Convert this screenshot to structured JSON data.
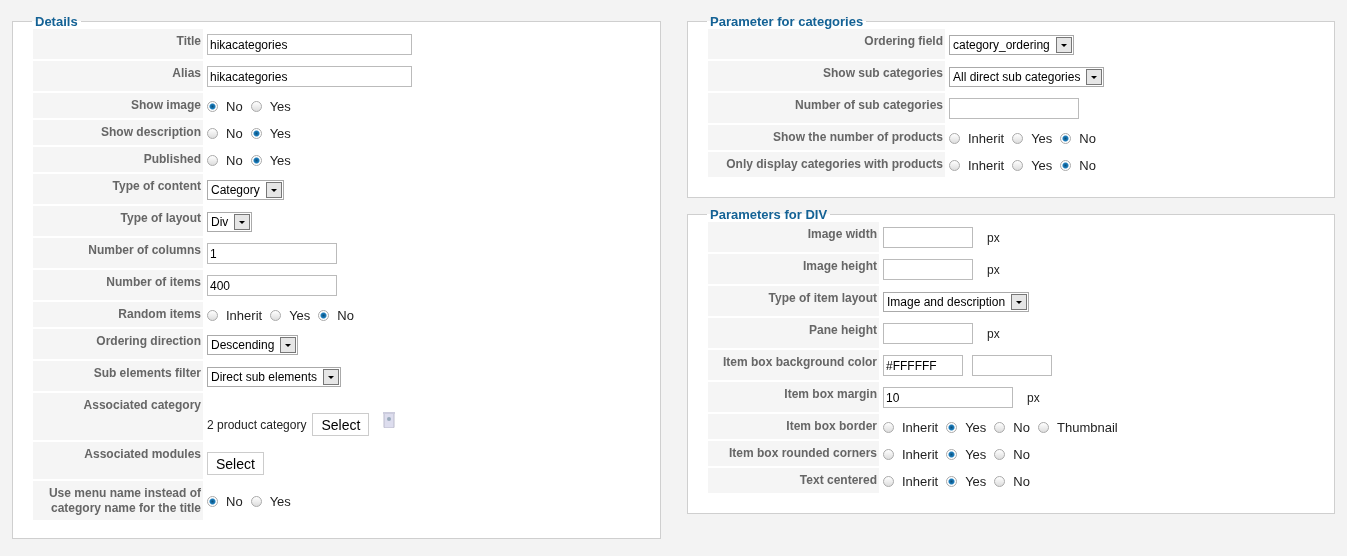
{
  "columns": [
    {
      "sections": [
        {
          "title": "Details",
          "rows": [
            {
              "label": "Title",
              "kind": "long-input",
              "value": "hikacategories"
            },
            {
              "label": "Alias",
              "kind": "long-input",
              "value": "hikacategories"
            },
            {
              "label": "Show image",
              "kind": "radio",
              "options": [
                {
                  "label": "No",
                  "selected": true
                },
                {
                  "label": "Yes",
                  "selected": false
                }
              ]
            },
            {
              "label": "Show description",
              "kind": "radio",
              "options": [
                {
                  "label": "No",
                  "selected": false
                },
                {
                  "label": "Yes",
                  "selected": true
                }
              ]
            },
            {
              "label": "Published",
              "kind": "radio",
              "options": [
                {
                  "label": "No",
                  "selected": false
                },
                {
                  "label": "Yes",
                  "selected": true
                }
              ]
            },
            {
              "label": "Type of content",
              "kind": "select",
              "value": "Category"
            },
            {
              "label": "Type of layout",
              "kind": "select",
              "value": "Div"
            },
            {
              "label": "Number of columns",
              "kind": "input",
              "value": "1"
            },
            {
              "label": "Number of items",
              "kind": "input",
              "value": "400"
            },
            {
              "label": "Random items",
              "kind": "radio",
              "options": [
                {
                  "label": "Inherit",
                  "selected": false
                },
                {
                  "label": "Yes",
                  "selected": false
                },
                {
                  "label": "No",
                  "selected": true
                }
              ]
            },
            {
              "label": "Ordering direction",
              "kind": "select",
              "value": "Descending"
            },
            {
              "label": "Sub elements filter",
              "kind": "select",
              "value": "Direct sub elements"
            },
            {
              "label": "Associated category",
              "kind": "category",
              "value": "2 product category",
              "button": "Select"
            },
            {
              "label": "Associated modules",
              "kind": "button",
              "button": "Select"
            },
            {
              "label": "Use menu name instead of category name for the title",
              "kind": "radio",
              "options": [
                {
                  "label": "No",
                  "selected": true
                },
                {
                  "label": "Yes",
                  "selected": false
                }
              ]
            }
          ]
        }
      ]
    },
    {
      "sections": [
        {
          "title": "Parameter for categories",
          "rows": [
            {
              "label": "Ordering field",
              "kind": "select",
              "value": "category_ordering"
            },
            {
              "label": "Show sub categories",
              "kind": "select",
              "value": "All direct sub categories"
            },
            {
              "label": "Number of sub categories",
              "kind": "input",
              "value": ""
            },
            {
              "label": "Show the number of products",
              "kind": "radio",
              "options": [
                {
                  "label": "Inherit",
                  "selected": false
                },
                {
                  "label": "Yes",
                  "selected": false
                },
                {
                  "label": "No",
                  "selected": true
                }
              ]
            },
            {
              "label": "Only display categories with products",
              "kind": "radio",
              "options": [
                {
                  "label": "Inherit",
                  "selected": false
                },
                {
                  "label": "Yes",
                  "selected": false
                },
                {
                  "label": "No",
                  "selected": true
                }
              ]
            }
          ]
        },
        {
          "title": "Parameters for DIV",
          "rows": [
            {
              "label": "Image width",
              "kind": "short-input",
              "value": "",
              "unit": "px"
            },
            {
              "label": "Image height",
              "kind": "short-input",
              "value": "",
              "unit": "px"
            },
            {
              "label": "Type of item layout",
              "kind": "select",
              "value": "Image and description"
            },
            {
              "label": "Pane height",
              "kind": "short-input",
              "value": "",
              "unit": "px"
            },
            {
              "label": "Item box background color",
              "kind": "color",
              "value": "#FFFFFF"
            },
            {
              "label": "Item box margin",
              "kind": "input",
              "value": "10",
              "unit": "px"
            },
            {
              "label": "Item box border",
              "kind": "radio",
              "options": [
                {
                  "label": "Inherit",
                  "selected": false
                },
                {
                  "label": "Yes",
                  "selected": true
                },
                {
                  "label": "No",
                  "selected": false
                },
                {
                  "label": "Thumbnail",
                  "selected": false
                }
              ]
            },
            {
              "label": "Item box rounded corners",
              "kind": "radio",
              "options": [
                {
                  "label": "Inherit",
                  "selected": false
                },
                {
                  "label": "Yes",
                  "selected": true
                },
                {
                  "label": "No",
                  "selected": false
                }
              ]
            },
            {
              "label": "Text centered",
              "kind": "radio",
              "options": [
                {
                  "label": "Inherit",
                  "selected": false
                },
                {
                  "label": "Yes",
                  "selected": true
                },
                {
                  "label": "No",
                  "selected": false
                }
              ]
            }
          ]
        }
      ]
    }
  ]
}
